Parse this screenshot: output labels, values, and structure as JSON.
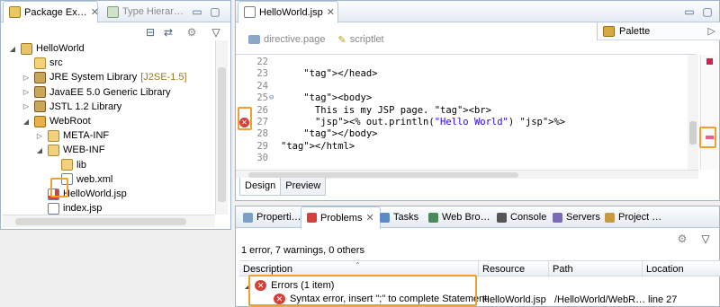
{
  "package_explorer": {
    "tabs": [
      {
        "label": "Package Ex…",
        "icon": "package-explorer-icon",
        "active": true
      },
      {
        "label": "Type Hierar…",
        "icon": "type-hierarchy-icon",
        "active": false
      }
    ],
    "tree": [
      {
        "label": "HelloWorld",
        "icon": "project-icon",
        "arrow": "◢",
        "indent": 0
      },
      {
        "label": "src",
        "icon": "source-folder-icon",
        "arrow": "",
        "indent": 1
      },
      {
        "label": "JRE System Library",
        "suffix": "[J2SE-1.5]",
        "icon": "library-icon",
        "arrow": "▷",
        "indent": 1
      },
      {
        "label": "JavaEE 5.0 Generic Library",
        "icon": "library-icon",
        "arrow": "▷",
        "indent": 1
      },
      {
        "label": "JSTL 1.2 Library",
        "icon": "library-icon",
        "arrow": "▷",
        "indent": 1
      },
      {
        "label": "WebRoot",
        "icon": "web-folder-icon",
        "arrow": "◢",
        "indent": 1
      },
      {
        "label": "META-INF",
        "icon": "folder-icon",
        "arrow": "▷",
        "indent": 2
      },
      {
        "label": "WEB-INF",
        "icon": "folder-icon",
        "arrow": "◢",
        "indent": 2
      },
      {
        "label": "lib",
        "icon": "folder-icon",
        "arrow": "",
        "indent": 3
      },
      {
        "label": "web.xml",
        "icon": "xml-file-icon",
        "arrow": "",
        "indent": 3
      },
      {
        "label": "HelloWorld.jsp",
        "icon": "jsp-error-icon",
        "arrow": "",
        "indent": 2
      },
      {
        "label": "index.jsp",
        "icon": "jsp-file-icon",
        "arrow": "",
        "indent": 2
      }
    ]
  },
  "editor": {
    "tab_label": "HelloWorld.jsp",
    "toolbar": [
      "directive.page",
      "scriptlet"
    ],
    "palette_label": "Palette",
    "lines": [
      {
        "n": "22",
        "text": ""
      },
      {
        "n": "23",
        "text": "    </head>"
      },
      {
        "n": "24",
        "text": ""
      },
      {
        "n": "25",
        "text": "    <body>",
        "fold": true
      },
      {
        "n": "26",
        "text": "      This is my JSP page. <br>"
      },
      {
        "n": "27",
        "text": "      <% out.println(\"Hello World\") %>",
        "error": true
      },
      {
        "n": "28",
        "text": "    </body>"
      },
      {
        "n": "29",
        "text": "</html>"
      },
      {
        "n": "30",
        "text": ""
      }
    ],
    "bottom_tabs": [
      "Design",
      "Preview"
    ]
  },
  "problems_view": {
    "tabs": [
      {
        "label": "Properti…",
        "icon": "properties-icon"
      },
      {
        "label": "Problems",
        "icon": "problems-icon",
        "active": true
      },
      {
        "label": "Tasks",
        "icon": "tasks-icon"
      },
      {
        "label": "Web Bro…",
        "icon": "web-browser-icon"
      },
      {
        "label": "Console",
        "icon": "console-icon"
      },
      {
        "label": "Servers",
        "icon": "servers-icon"
      },
      {
        "label": "Project …",
        "icon": "project-icon"
      }
    ],
    "summary": "1 error, 7 warnings, 0 others",
    "columns": [
      "Description",
      "Resource",
      "Path",
      "Location"
    ],
    "group_label": "Errors (1 item)",
    "error_row": {
      "description": "Syntax error, insert \";\" to complete Statement",
      "resource": "HelloWorld.jsp",
      "path": "/HelloWorld/WebR…",
      "location": "line 27"
    }
  },
  "colors": {
    "highlight": "#f0a030",
    "error": "#d32f2f",
    "tab_border": "#b9c9dc"
  }
}
